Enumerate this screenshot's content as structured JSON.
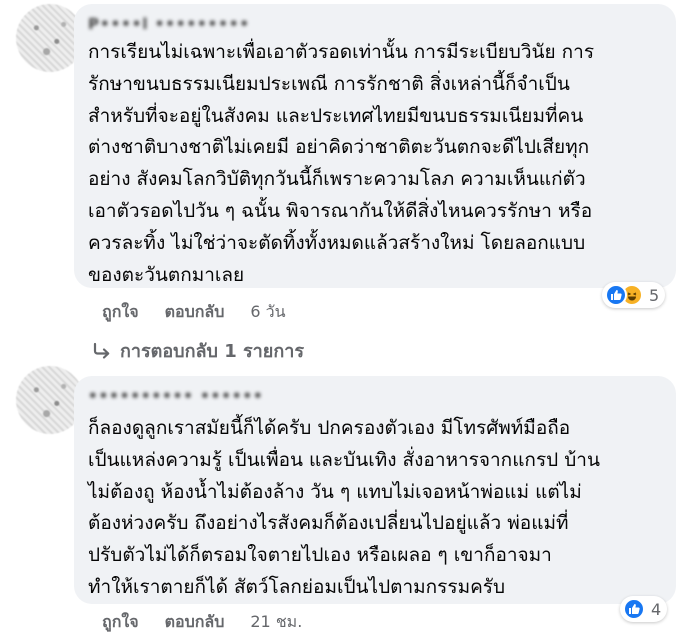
{
  "comments": [
    {
      "author": "P••••l •••••••••",
      "lines": [
        "การเรียนไม่เฉพาะเพื่อเอาตัวรอดเท่านั้น การมีระเบียบวินัย การ",
        "รักษาขนบธรรมเนียมประเพณี การรักชาติ สิ่งเหล่านี้ก็จำเป็น",
        "สำหรับที่จะอยู่ในสังคม และประเทศไทยมีขนบธรรมเนียมที่คน",
        "ต่างชาติบางชาติไม่เคยมี อย่าคิดว่าชาติตะวันตกจะดีไปเสียทุก",
        "อย่าง สังคมโลกวิบัติทุกวันนี้ก็เพราะความโลภ ความเห็นแก่ตัว",
        "เอาตัวรอดไปวัน ๆ ฉนั้น พิจารณากันให้ดีสิ่งไหนควรรักษา หรือ",
        "ควรละทิ้ง ไม่ใช่ว่าจะตัดทิ้งทั้งหมดแล้วสร้างใหม่ โดยลอกแบบ",
        "ของตะวันตกมาเลย"
      ],
      "like_label": "ถูกใจ",
      "reply_label": "ตอบกลับ",
      "time": "6 วัน",
      "reaction_count": "5",
      "reaction_icons": [
        "like-icon",
        "haha-icon"
      ],
      "replies_label": "การตอบกลับ 1 รายการ"
    },
    {
      "author": "•••••••••• ••••••",
      "lines": [
        "ก็ลองดูลูกเราสมัยนี้ก็ได้ครับ ปกครองตัวเอง มีโทรศัพท์มือถือ",
        "เป็นแหล่งความรู้ เป็นเพื่อน และบันเทิง สั่งอาหารจากแกรป บ้าน",
        "ไม่ต้องถู ห้องน้ำไม่ต้องล้าง วัน ๆ แทบไม่เจอหน้าพ่อแม่ แต่ไม่",
        "ต้องห่วงครับ ถึงอย่างไรสังคมก็ต้องเปลี่ยนไปอยู่แล้ว พ่อแม่ที่",
        "ปรับตัวไม่ได้ก็ตรอมใจตายไปเอง หรือเผลอ ๆ เขาก็อาจมา",
        "ทำให้เราตายก็ได้ สัตว์โลกย่อมเป็นไปตามกรรมครับ"
      ],
      "like_label": "ถูกใจ",
      "reply_label": "ตอบกลับ",
      "time": "21 ชม.",
      "reaction_count": "4",
      "reaction_icons": [
        "like-icon"
      ]
    }
  ],
  "colors": {
    "bubble": "#f0f2f5",
    "text": "#050505",
    "muted": "#65676b",
    "like_blue": "#1877f2",
    "haha_yellow": "#f7b125"
  }
}
